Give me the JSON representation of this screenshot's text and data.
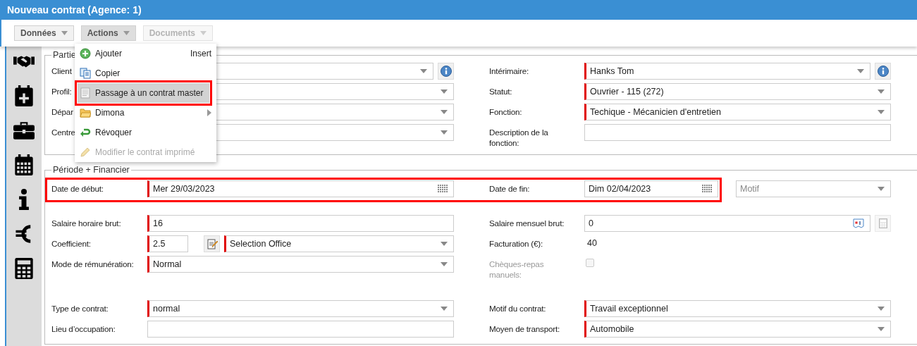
{
  "window": {
    "title": "Nouveau contrat (Agence: 1)"
  },
  "toolbar": [
    {
      "label": "Données",
      "selected": false,
      "disabled": false
    },
    {
      "label": "Actions",
      "selected": true,
      "disabled": false
    },
    {
      "label": "Documents",
      "selected": false,
      "disabled": true
    }
  ],
  "menu": {
    "items": [
      {
        "kind": "add",
        "label": "Ajouter",
        "shortcut": "Insert",
        "selected": false,
        "disabled": false,
        "annotated": false
      },
      {
        "kind": "copy",
        "label": "Copier",
        "selected": false,
        "disabled": false,
        "annotated": false
      },
      {
        "kind": "document",
        "label": "Passage à un contrat master",
        "selected": true,
        "disabled": false,
        "annotated": true
      },
      {
        "kind": "folder",
        "label": "Dimona",
        "submenu": true,
        "selected": false,
        "disabled": false,
        "annotated": false
      },
      {
        "kind": "revoke",
        "label": "Révoquer",
        "selected": false,
        "disabled": false,
        "annotated": false
      },
      {
        "kind": "edit",
        "label": "Modifier le contrat imprimé",
        "selected": false,
        "disabled": true,
        "annotated": false
      }
    ]
  },
  "sections": [
    {
      "legend": "Partie",
      "groups": [
        {
          "rows": [
            {
              "left": {
                "label": "Client",
                "fields": [
                  {
                    "kind": "select"
                  },
                  {
                    "kind": "info_button"
                  }
                ]
              },
              "right": {
                "label": "Intérimaire:",
                "fields": [
                  {
                    "kind": "select",
                    "value": "Hanks Tom",
                    "required": true
                  },
                  {
                    "kind": "info_button"
                  }
                ]
              }
            },
            {
              "left": {
                "label": "Profil:",
                "fields": [
                  {
                    "kind": "select"
                  }
                ]
              },
              "right": {
                "label": "Statut:",
                "fields": [
                  {
                    "kind": "select",
                    "value": "Ouvrier - 115 (272)",
                    "required": true
                  }
                ]
              }
            },
            {
              "left": {
                "label": "Dépar",
                "fields": [
                  {
                    "kind": "select"
                  }
                ]
              },
              "right": {
                "label": "Fonction:",
                "fields": [
                  {
                    "kind": "select",
                    "value": "Techique - Mécanicien d'entretien",
                    "required": true
                  }
                ]
              }
            },
            {
              "left": {
                "label": "Centre",
                "fields": [
                  {
                    "kind": "select"
                  }
                ]
              },
              "right": {
                "label": "Description de la fonction:",
                "fields": [
                  {
                    "kind": "text",
                    "required": false
                  }
                ]
              }
            }
          ]
        }
      ]
    },
    {
      "legend": "Période + Financier",
      "groups": [
        {
          "rows": [
            {
              "annotated": true,
              "left": {
                "label": "Date de début:",
                "fields": [
                  {
                    "kind": "date",
                    "value": "Mer 29/03/2023",
                    "required": true
                  }
                ]
              },
              "right": {
                "label": "Date de fin:",
                "fields": [
                  {
                    "kind": "date",
                    "value": "Dim 02/04/2023",
                    "required": false
                  }
                ]
              },
              "trailing": {
                "kind": "select",
                "placeholder": "Motif",
                "required": false
              }
            }
          ]
        },
        {
          "rows": [
            {
              "left": {
                "label": "Salaire horaire brut:",
                "fields": [
                  {
                    "kind": "text",
                    "value": "16",
                    "required": true
                  }
                ]
              },
              "right": {
                "label": "Salaire mensuel brut:",
                "fields": [
                  {
                    "kind": "amount",
                    "value": "0",
                    "required": false
                  },
                  {
                    "kind": "calc_button",
                    "disabled": true
                  }
                ]
              }
            },
            {
              "left": {
                "label": "Coefficient:",
                "fields": [
                  {
                    "kind": "number",
                    "value": "2.5",
                    "required": true
                  },
                  {
                    "kind": "note_button"
                  },
                  {
                    "kind": "select",
                    "value": "Selection Office",
                    "required": true
                  }
                ]
              },
              "right": {
                "label": "Facturation (€):",
                "fields": [
                  {
                    "kind": "static",
                    "value": "40"
                  }
                ]
              }
            },
            {
              "left": {
                "label": "Mode de rémunération:",
                "fields": [
                  {
                    "kind": "select",
                    "value": "Normal",
                    "required": true
                  }
                ]
              },
              "right": {
                "label": "Chèques-repas manuels:",
                "disabled": true,
                "fields": [
                  {
                    "kind": "checkbox",
                    "checked": false
                  }
                ]
              }
            }
          ]
        },
        {
          "rows": [
            {
              "left": {
                "label": "Type de contrat:",
                "fields": [
                  {
                    "kind": "select",
                    "value": "normal",
                    "required": true
                  }
                ]
              },
              "right": {
                "label": "Motif du contrat:",
                "fields": [
                  {
                    "kind": "select",
                    "value": "Travail exceptionnel",
                    "required": true
                  }
                ]
              }
            },
            {
              "left": {
                "label": "Lieu d’occupation:",
                "fields": [
                  {
                    "kind": "text",
                    "required": false
                  }
                ]
              },
              "right": {
                "label": "Moyen de transport:",
                "fields": [
                  {
                    "kind": "select",
                    "value": "Automobile",
                    "required": true
                  }
                ]
              }
            }
          ]
        }
      ]
    }
  ]
}
